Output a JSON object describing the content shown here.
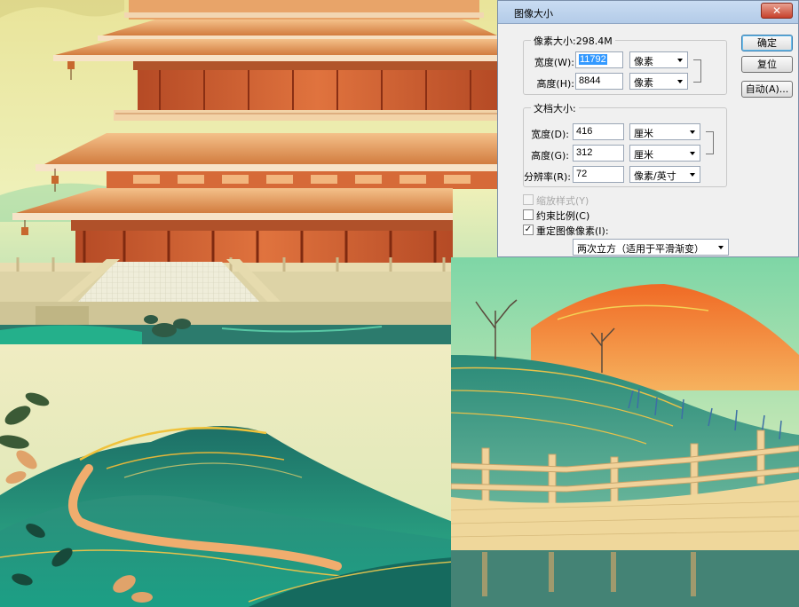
{
  "dialog": {
    "title": "图像大小",
    "close_symbol": "✕",
    "pixel_dimensions": {
      "label": "像素大小:298.4M",
      "width_label": "宽度(W):",
      "width_value": "11792",
      "width_unit": "像素",
      "height_label": "高度(H):",
      "height_value": "8844",
      "height_unit": "像素"
    },
    "document_size": {
      "label": "文档大小:",
      "width_label": "宽度(D):",
      "width_value": "416",
      "width_unit": "厘米",
      "height_label": "高度(G):",
      "height_value": "312",
      "height_unit": "厘米",
      "resolution_label": "分辨率(R):",
      "resolution_value": "72",
      "resolution_unit": "像素/英寸"
    },
    "options": {
      "scale_styles": "缩放样式(Y)",
      "constrain_proportions": "约束比例(C)",
      "resample_image": "重定图像像素(I):",
      "resample_method": "两次立方（适用于平滑渐变）"
    },
    "buttons": {
      "ok": "确定",
      "reset": "复位",
      "auto": "自动(A)..."
    }
  }
}
